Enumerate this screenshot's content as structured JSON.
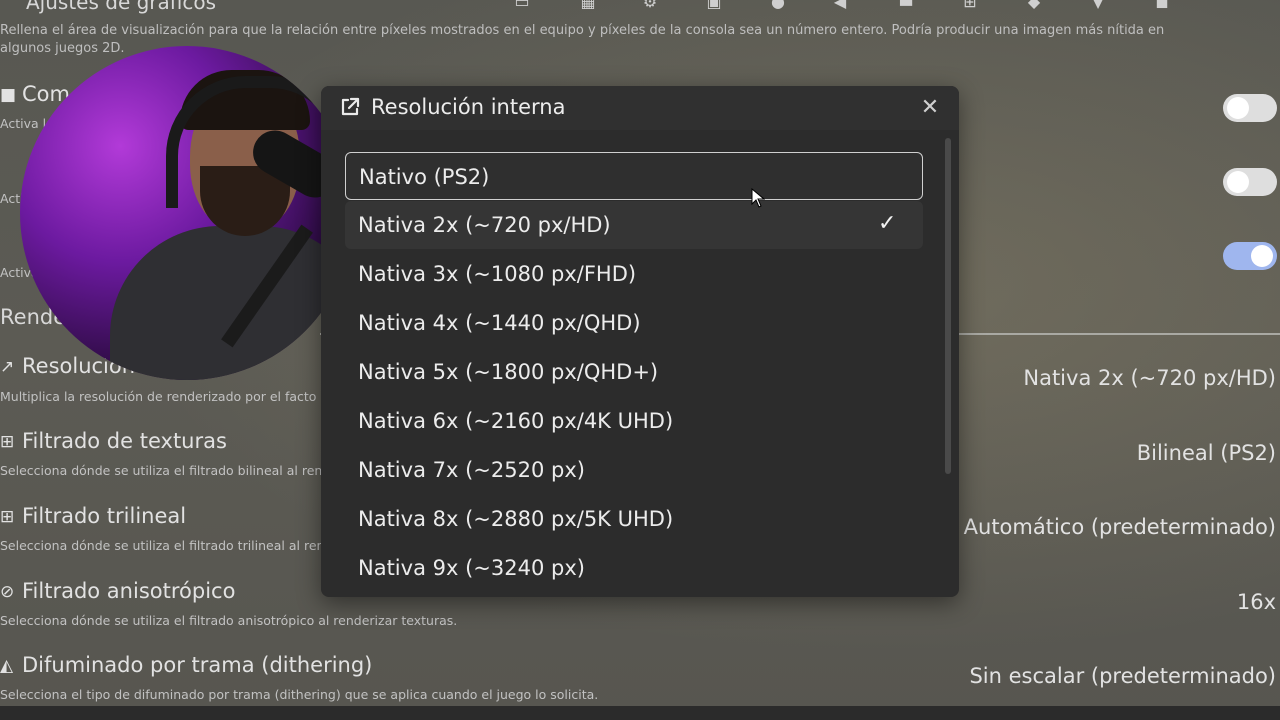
{
  "background": {
    "page_title": "Ajustes de gráficos",
    "intro_desc": "Rellena el área de visualización para que la relación entre píxeles mostrados en el equipo y píxeles de la consola sea un número entero. Podría producir una imagen más nítida en algunos juegos 2D.",
    "top_icons": [
      "monitor-icon",
      "chip-icon",
      "gears-icon",
      "image-icon",
      "gamepad-icon",
      "speaker-icon",
      "memory-card-icon",
      "network-icon",
      "eraser-icon",
      "trophy-icon",
      "controller-icon"
    ],
    "rows_top": [
      {
        "title": "Com",
        "desc": "Activa la"
      },
      {
        "title": "",
        "desc": "Activa"
      },
      {
        "title": "",
        "desc": "Activa"
      }
    ],
    "section_label": "Render",
    "settings": [
      {
        "title": "Resolución",
        "desc": "Multiplica la resolución de renderizado por el facto",
        "value": "Nativa 2x (~720 px/HD)"
      },
      {
        "title": "Filtrado de texturas",
        "desc": "Selecciona dónde se utiliza el filtrado bilineal al ren",
        "value": "Bilineal (PS2)"
      },
      {
        "title": "Filtrado trilineal",
        "desc": "Selecciona dónde se utiliza el filtrado trilineal al ren",
        "value": "Automático (predeterminado)"
      },
      {
        "title": "Filtrado anisotrópico",
        "desc": "Selecciona dónde se utiliza el filtrado anisotrópico al renderizar texturas.",
        "value": "16x"
      },
      {
        "title": "Difuminado por trama (dithering)",
        "desc": "Selecciona el tipo de difuminado por trama (dithering) que se aplica cuando el juego lo solicita.",
        "value": "Sin escalar (predeterminado)"
      }
    ],
    "toggles": [
      "off",
      "off",
      "on"
    ]
  },
  "dialog": {
    "title": "Resolución interna",
    "hovered_index": 0,
    "selected_index": 1,
    "options": [
      "Nativo (PS2)",
      "Nativa 2x (~720 px/HD)",
      "Nativa 3x (~1080 px/FHD)",
      "Nativa 4x (~1440 px/QHD)",
      "Nativa 5x (~1800 px/QHD+)",
      "Nativa 6x (~2160 px/4K UHD)",
      "Nativa 7x (~2520 px)",
      "Nativa 8x (~2880 px/5K UHD)",
      "Nativa 9x (~3240 px)"
    ]
  }
}
